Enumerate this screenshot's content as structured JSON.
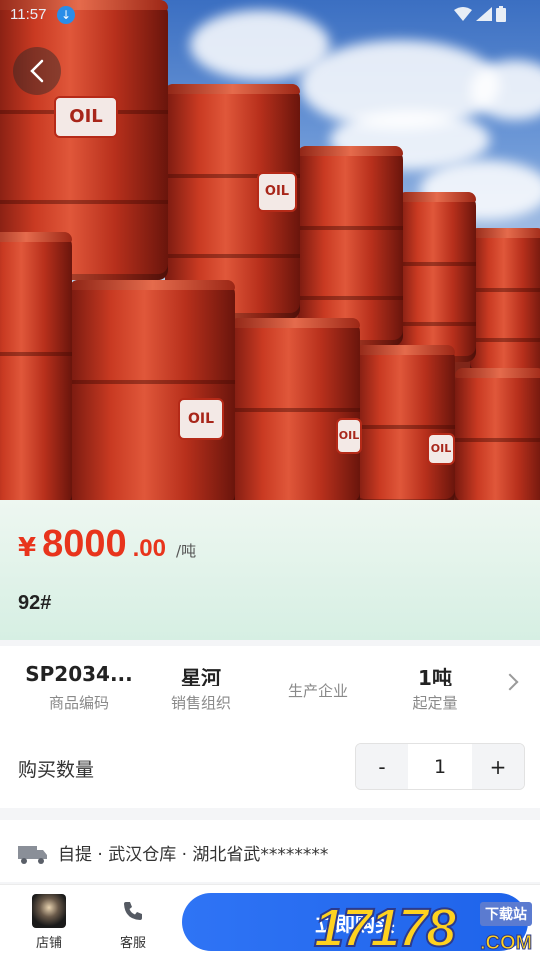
{
  "status_bar": {
    "time": "11:57"
  },
  "price": {
    "currency": "¥",
    "integer": "8000",
    "decimal": ".00",
    "unit": "/吨"
  },
  "product": {
    "grade": "92#"
  },
  "info": [
    {
      "value": "SP2034...",
      "label": "商品编码"
    },
    {
      "value": "星河",
      "label": "销售组织"
    },
    {
      "value": "",
      "label": "生产企业"
    },
    {
      "value": "1吨",
      "label": "起定量"
    }
  ],
  "quantity": {
    "label": "购买数量",
    "minus": "-",
    "value": "1",
    "plus": "+"
  },
  "pickup": {
    "text": "自提 · 武汉仓库 · 湖北省武********"
  },
  "hero": {
    "barrel_label": "OIL"
  },
  "bottom": {
    "shop_label": "店铺",
    "service_label": "客服",
    "buy_label": "立即购买"
  },
  "watermark": {
    "number": "17178",
    "tag": "下载站",
    "domain": ".COM"
  },
  "colors": {
    "price": "#e8341c",
    "buy_button": "#2f74f5",
    "panel": "#d6efe3"
  }
}
